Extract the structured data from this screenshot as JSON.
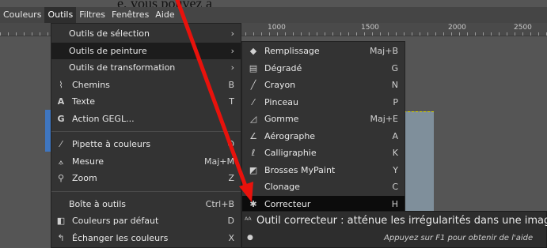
{
  "top_text": "e, vous pouvez a",
  "menubar": {
    "items": [
      "Couleurs",
      "Outils",
      "Filtres",
      "Fenêtres",
      "Aide"
    ],
    "active_index": 1
  },
  "ruler": {
    "labels": [
      "1000",
      "1500",
      "2000",
      "2500"
    ]
  },
  "outils_menu": {
    "items": [
      {
        "label": "Outils de sélection",
        "accel": "",
        "submenu": true,
        "icon": ""
      },
      {
        "label": "Outils de peinture",
        "accel": "",
        "submenu": true,
        "icon": "",
        "selected": true
      },
      {
        "label": "Outils de transformation",
        "accel": "",
        "submenu": true,
        "icon": ""
      },
      {
        "label": "Chemins",
        "accel": "B",
        "submenu": false,
        "icon": "paths-icon"
      },
      {
        "label": "Texte",
        "accel": "T",
        "submenu": false,
        "icon": "text-tool-icon"
      },
      {
        "label": "Action GEGL...",
        "accel": "",
        "submenu": false,
        "icon": "gegl-icon"
      },
      {
        "separator": true
      },
      {
        "label": "Pipette à couleurs",
        "accel": "O",
        "submenu": false,
        "icon": "color-picker-icon"
      },
      {
        "label": "Mesure",
        "accel": "Maj+M",
        "submenu": false,
        "icon": "measure-icon"
      },
      {
        "label": "Zoom",
        "accel": "Z",
        "submenu": false,
        "icon": "zoom-icon"
      },
      {
        "separator": true
      },
      {
        "label": "Boîte à outils",
        "accel": "Ctrl+B",
        "submenu": false,
        "icon": ""
      },
      {
        "label": "Couleurs par défaut",
        "accel": "D",
        "submenu": false,
        "icon": "default-colors-icon"
      },
      {
        "label": "Échanger les couleurs",
        "accel": "X",
        "submenu": false,
        "icon": "swap-colors-icon"
      }
    ]
  },
  "peinture_menu": {
    "items": [
      {
        "label": "Remplissage",
        "accel": "Maj+B",
        "icon": "bucket-fill-icon"
      },
      {
        "label": "Dégradé",
        "accel": "G",
        "icon": "gradient-icon"
      },
      {
        "label": "Crayon",
        "accel": "N",
        "icon": "pencil-icon"
      },
      {
        "label": "Pinceau",
        "accel": "P",
        "icon": "paintbrush-icon"
      },
      {
        "label": "Gomme",
        "accel": "Maj+E",
        "icon": "eraser-icon"
      },
      {
        "label": "Aérographe",
        "accel": "A",
        "icon": "airbrush-icon"
      },
      {
        "label": "Calligraphie",
        "accel": "K",
        "icon": "ink-icon"
      },
      {
        "label": "Brosses MyPaint",
        "accel": "Y",
        "icon": "mypaint-brush-icon"
      },
      {
        "label": "Clonage",
        "accel": "C",
        "icon": "clone-icon"
      },
      {
        "label": "Correcteur",
        "accel": "H",
        "icon": "heal-icon",
        "selected": true
      }
    ]
  },
  "tooltip": {
    "title": "Outil correcteur : atténue les irrégularités dans une image",
    "hint": "Appuyez sur F1 pour obtenir de l'aide"
  },
  "colors": {
    "annotation_arrow": "#e8120c",
    "selection_bg": "#1c1c1c",
    "menu_bg": "#333333"
  }
}
